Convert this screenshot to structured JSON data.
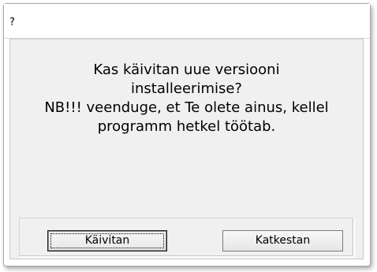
{
  "dialog": {
    "title": "?",
    "message_lines": [
      "Kas käivitan uue versiooni",
      "installeerimise?",
      "NB!!! veenduge, et Te olete ainus, kellel",
      "programm hetkel töötab."
    ],
    "buttons": {
      "confirm_label": "Käivitan",
      "cancel_label": "Katkestan"
    }
  }
}
